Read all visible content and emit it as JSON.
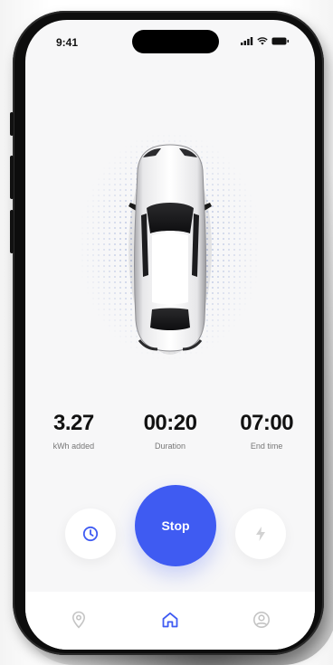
{
  "status_bar": {
    "time": "9:41",
    "icons": [
      "signal-icon",
      "wifi-icon",
      "battery-icon"
    ]
  },
  "vehicle": {
    "image": "car-top-view"
  },
  "stats": [
    {
      "value": "3.27",
      "label": "kWh added"
    },
    {
      "value": "00:20",
      "label": "Duration"
    },
    {
      "value": "07:00",
      "label": "End time"
    }
  ],
  "controls": {
    "left_icon": "clock-icon",
    "stop_label": "Stop",
    "right_icon": "lightning-icon"
  },
  "tabbar": {
    "items": [
      {
        "icon": "location-pin-icon",
        "active": false
      },
      {
        "icon": "home-icon",
        "active": true
      },
      {
        "icon": "profile-icon",
        "active": false
      }
    ]
  },
  "colors": {
    "accent": "#3f5bf2",
    "inactive": "#c4c4c4",
    "background": "#f7f7f8"
  }
}
